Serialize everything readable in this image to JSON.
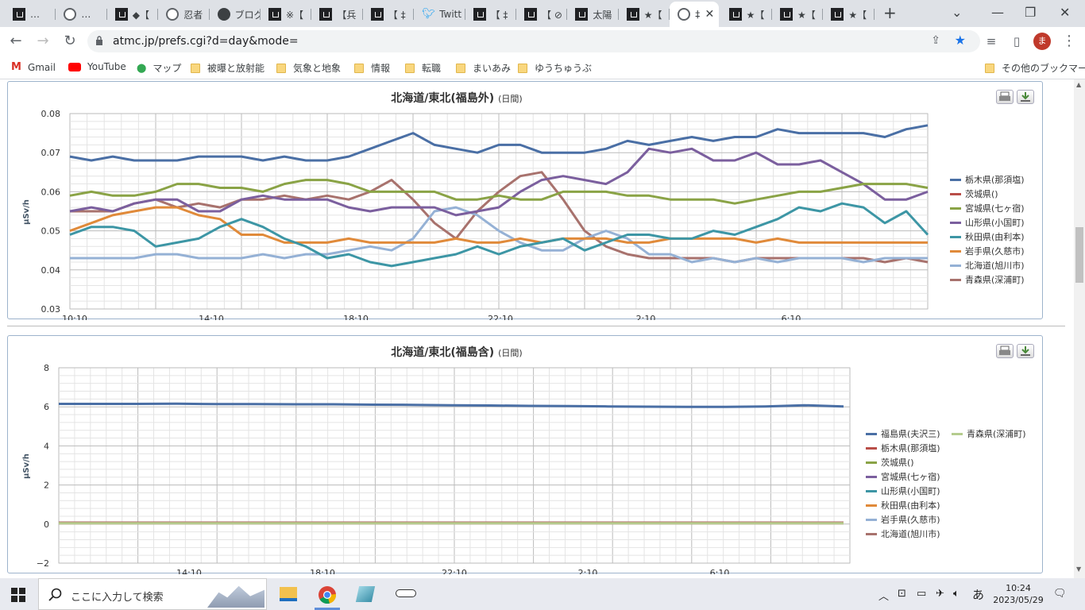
{
  "browser": {
    "tabs": [
      {
        "label": "…",
        "icon": "site-icon"
      },
      {
        "label": "…",
        "icon": "globe-icon"
      },
      {
        "label": "◆【",
        "icon": "site-icon"
      },
      {
        "label": "忍者",
        "icon": "globe-icon"
      },
      {
        "label": "ブログ",
        "icon": "blog-icon"
      },
      {
        "label": "※【",
        "icon": "site-icon"
      },
      {
        "label": "【兵",
        "icon": "site-icon"
      },
      {
        "label": "【 ‡",
        "icon": "site-icon"
      },
      {
        "label": "Twitt",
        "icon": "twitter-icon"
      },
      {
        "label": "【 ‡",
        "icon": "site-icon"
      },
      {
        "label": "【 ⊘",
        "icon": "site-icon"
      },
      {
        "label": "太陽",
        "icon": "site-icon"
      },
      {
        "label": "★【",
        "icon": "site-icon"
      },
      {
        "label": "‡",
        "icon": "globe-icon",
        "active": true
      },
      {
        "label": "★【",
        "icon": "site-icon"
      },
      {
        "label": "★【",
        "icon": "site-icon"
      },
      {
        "label": "★【",
        "icon": "site-icon"
      }
    ],
    "new_tab": "+",
    "url": "atmc.jp/prefs.cgi?d=day&mode=",
    "profile_initial": "ま",
    "bookmarks": [
      {
        "label": "Gmail",
        "icon": "gmail-icon"
      },
      {
        "label": "YouTube",
        "icon": "youtube-icon"
      },
      {
        "label": "マップ",
        "icon": "maps-icon"
      },
      {
        "label": "被曝と放射能",
        "icon": "folder-icon"
      },
      {
        "label": "気象と地象",
        "icon": "folder-icon"
      },
      {
        "label": "情報",
        "icon": "folder-icon"
      },
      {
        "label": "転職",
        "icon": "folder-icon"
      },
      {
        "label": "まいあみ",
        "icon": "folder-icon"
      },
      {
        "label": "ゆうちゅうぶ",
        "icon": "folder-icon"
      }
    ],
    "other_bookmarks": "その他のブックマーク"
  },
  "chart_data": [
    {
      "type": "line",
      "title": "北海道/東北(福島外)",
      "title_suffix": "(日間)",
      "ylabel": "μSv/h",
      "ylim": [
        0.03,
        0.08
      ],
      "yticks": [
        "0.08",
        "0.07",
        "0.06",
        "0.05",
        "0.04",
        "0.03"
      ],
      "xticks": [
        "10:10",
        "14:10",
        "18:10",
        "22:10",
        "2:10",
        "6:10"
      ],
      "grid": true,
      "legend_position": "right",
      "series": [
        {
          "name": "栃木県(那須塩)",
          "color": "#4a6fa5",
          "values": [
            0.069,
            0.068,
            0.069,
            0.068,
            0.068,
            0.068,
            0.069,
            0.069,
            0.069,
            0.068,
            0.069,
            0.068,
            0.068,
            0.069,
            0.071,
            0.073,
            0.075,
            0.072,
            0.071,
            0.07,
            0.072,
            0.072,
            0.07,
            0.07,
            0.07,
            0.071,
            0.073,
            0.072,
            0.073,
            0.074,
            0.073,
            0.074,
            0.074,
            0.076,
            0.075,
            0.075,
            0.075,
            0.075,
            0.074,
            0.076,
            0.077
          ]
        },
        {
          "name": "茨城県()",
          "color": "#b94e48",
          "values": []
        },
        {
          "name": "宮城県(七ヶ宿)",
          "color": "#8aa346",
          "values": [
            0.059,
            0.06,
            0.059,
            0.059,
            0.06,
            0.062,
            0.062,
            0.061,
            0.061,
            0.06,
            0.062,
            0.063,
            0.063,
            0.062,
            0.06,
            0.06,
            0.06,
            0.06,
            0.058,
            0.058,
            0.059,
            0.058,
            0.058,
            0.06,
            0.06,
            0.06,
            0.059,
            0.059,
            0.058,
            0.058,
            0.058,
            0.057,
            0.058,
            0.059,
            0.06,
            0.06,
            0.061,
            0.062,
            0.062,
            0.062,
            0.061
          ]
        },
        {
          "name": "山形県(小国町)",
          "color": "#7b5f9e",
          "values": [
            0.055,
            0.056,
            0.055,
            0.057,
            0.058,
            0.058,
            0.055,
            0.055,
            0.058,
            0.059,
            0.058,
            0.058,
            0.058,
            0.056,
            0.055,
            0.056,
            0.056,
            0.056,
            0.054,
            0.055,
            0.056,
            0.06,
            0.063,
            0.064,
            0.063,
            0.062,
            0.065,
            0.071,
            0.07,
            0.071,
            0.068,
            0.068,
            0.07,
            0.067,
            0.067,
            0.068,
            0.065,
            0.062,
            0.058,
            0.058,
            0.06
          ]
        },
        {
          "name": "秋田県(由利本)",
          "color": "#3d96a5",
          "values": [
            0.049,
            0.051,
            0.051,
            0.05,
            0.046,
            0.047,
            0.048,
            0.051,
            0.053,
            0.051,
            0.048,
            0.046,
            0.043,
            0.044,
            0.042,
            0.041,
            0.042,
            0.043,
            0.044,
            0.046,
            0.044,
            0.046,
            0.047,
            0.048,
            0.045,
            0.047,
            0.049,
            0.049,
            0.048,
            0.048,
            0.05,
            0.049,
            0.051,
            0.053,
            0.056,
            0.055,
            0.057,
            0.056,
            0.052,
            0.055,
            0.049
          ]
        },
        {
          "name": "岩手県(久慈市)",
          "color": "#e08a3a",
          "values": [
            0.05,
            0.052,
            0.054,
            0.055,
            0.056,
            0.056,
            0.054,
            0.053,
            0.049,
            0.049,
            0.047,
            0.047,
            0.047,
            0.048,
            0.047,
            0.047,
            0.047,
            0.047,
            0.048,
            0.047,
            0.047,
            0.048,
            0.047,
            0.048,
            0.048,
            0.048,
            0.047,
            0.047,
            0.048,
            0.048,
            0.048,
            0.048,
            0.047,
            0.048,
            0.047,
            0.047,
            0.047,
            0.047,
            0.047,
            0.047,
            0.047
          ]
        },
        {
          "name": "北海道(旭川市)",
          "color": "#95b1d5",
          "values": [
            0.043,
            0.043,
            0.043,
            0.043,
            0.044,
            0.044,
            0.043,
            0.043,
            0.043,
            0.044,
            0.043,
            0.044,
            0.044,
            0.045,
            0.046,
            0.045,
            0.048,
            0.055,
            0.056,
            0.054,
            0.05,
            0.047,
            0.045,
            0.045,
            0.048,
            0.05,
            0.048,
            0.044,
            0.044,
            0.042,
            0.043,
            0.042,
            0.043,
            0.042,
            0.043,
            0.043,
            0.043,
            0.042,
            0.043,
            0.043,
            0.043
          ]
        },
        {
          "name": "青森県(深浦町)",
          "color": "#a8726d",
          "values": [
            0.055,
            0.055,
            0.055,
            0.057,
            0.058,
            0.056,
            0.057,
            0.056,
            0.058,
            0.058,
            0.059,
            0.058,
            0.059,
            0.058,
            0.06,
            0.063,
            0.058,
            0.052,
            0.048,
            0.055,
            0.06,
            0.064,
            0.065,
            0.058,
            0.05,
            0.046,
            0.044,
            0.043,
            0.043,
            0.043,
            0.043,
            0.042,
            0.043,
            0.043,
            0.043,
            0.043,
            0.043,
            0.043,
            0.042,
            0.043,
            0.042
          ]
        }
      ]
    },
    {
      "type": "line",
      "title": "北海道/東北(福島含)",
      "title_suffix": "(日間)",
      "ylabel": "μSv/h",
      "ylim": [
        -2,
        8
      ],
      "yticks": [
        "8",
        "6",
        "4",
        "2",
        "0",
        "−2"
      ],
      "xticks": [
        "14:10",
        "18:10",
        "22:10",
        "2:10",
        "6:10"
      ],
      "grid": true,
      "legend_position": "right",
      "series": [
        {
          "name": "福島県(夫沢三)",
          "color": "#4a6fa5",
          "values": [
            6.15,
            6.15,
            6.15,
            6.16,
            6.14,
            6.14,
            6.13,
            6.13,
            6.11,
            6.1,
            6.08,
            6.07,
            6.05,
            6.04,
            6.02,
            6.01,
            6.0,
            6.0,
            6.02,
            6.08,
            6.02
          ]
        },
        {
          "name": "青森県(深浦町)",
          "color": "#b5cc8e",
          "values": [
            0.04,
            0.04,
            0.04,
            0.04,
            0.04,
            0.04,
            0.04,
            0.04,
            0.04,
            0.04,
            0.04,
            0.04,
            0.04,
            0.04,
            0.04,
            0.04,
            0.04,
            0.04,
            0.04,
            0.04,
            0.04
          ]
        },
        {
          "name": "栃木県(那須塩)",
          "color": "#b94e48",
          "values": [
            0.07,
            0.07,
            0.07,
            0.07,
            0.07,
            0.07,
            0.07,
            0.07,
            0.07,
            0.07,
            0.07,
            0.07,
            0.07,
            0.07,
            0.07,
            0.07,
            0.07,
            0.07,
            0.07,
            0.07,
            0.07
          ]
        },
        {
          "name": "茨城県()",
          "color": "#8aa346",
          "values": []
        },
        {
          "name": "宮城県(七ヶ宿)",
          "color": "#7b5f9e",
          "values": [
            0.06,
            0.06,
            0.06,
            0.06,
            0.06,
            0.06,
            0.06,
            0.06,
            0.06,
            0.06,
            0.06,
            0.06,
            0.06,
            0.06,
            0.06,
            0.06,
            0.06,
            0.06,
            0.06,
            0.06,
            0.06
          ]
        },
        {
          "name": "山形県(小国町)",
          "color": "#3d96a5",
          "values": [
            0.06,
            0.06,
            0.06,
            0.06,
            0.06,
            0.06,
            0.06,
            0.06,
            0.06,
            0.06,
            0.06,
            0.06,
            0.06,
            0.06,
            0.06,
            0.06,
            0.06,
            0.06,
            0.06,
            0.06,
            0.06
          ]
        },
        {
          "name": "秋田県(由利本)",
          "color": "#e08a3a",
          "values": [
            0.05,
            0.05,
            0.05,
            0.05,
            0.05,
            0.05,
            0.05,
            0.05,
            0.05,
            0.05,
            0.05,
            0.05,
            0.05,
            0.05,
            0.05,
            0.05,
            0.05,
            0.05,
            0.05,
            0.05,
            0.05
          ]
        },
        {
          "name": "岩手県(久慈市)",
          "color": "#95b1d5",
          "values": [
            0.05,
            0.05,
            0.05,
            0.05,
            0.05,
            0.05,
            0.05,
            0.05,
            0.05,
            0.05,
            0.05,
            0.05,
            0.05,
            0.05,
            0.05,
            0.05,
            0.05,
            0.05,
            0.05,
            0.05,
            0.05
          ]
        },
        {
          "name": "北海道(旭川市)",
          "color": "#a8726d",
          "values": [
            0.04,
            0.04,
            0.04,
            0.04,
            0.04,
            0.04,
            0.04,
            0.04,
            0.04,
            0.04,
            0.04,
            0.04,
            0.04,
            0.04,
            0.04,
            0.04,
            0.04,
            0.04,
            0.04,
            0.04,
            0.04
          ]
        }
      ]
    }
  ],
  "taskbar": {
    "search_placeholder": "ここに入力して検索",
    "time": "10:24",
    "date": "2023/05/29",
    "ime": "あ"
  }
}
